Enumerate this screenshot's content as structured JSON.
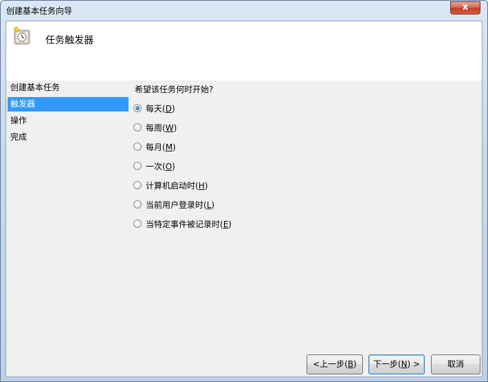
{
  "window": {
    "title": "创建基本任务向导",
    "close_glyph": "x"
  },
  "header": {
    "title": "任务触发器",
    "icon": "clock-icon"
  },
  "nav": {
    "items": [
      {
        "label": "创建基本任务",
        "selected": false
      },
      {
        "label": "触发器",
        "selected": true
      },
      {
        "label": "操作",
        "selected": false
      },
      {
        "label": "完成",
        "selected": false
      }
    ]
  },
  "content": {
    "question": "希望该任务何时开始?",
    "options": [
      {
        "text": "每天(",
        "key": "D",
        "close": ")",
        "checked": true
      },
      {
        "text": "每周(",
        "key": "W",
        "close": ")",
        "checked": false
      },
      {
        "text": "每月(",
        "key": "M",
        "close": ")",
        "checked": false
      },
      {
        "text": "一次(",
        "key": "O",
        "close": ")",
        "checked": false
      },
      {
        "text": "计算机启动时(",
        "key": "H",
        "close": ")",
        "checked": false
      },
      {
        "text": "当前用户登录时(",
        "key": "L",
        "close": ")",
        "checked": false
      },
      {
        "text": "当特定事件被记录时(",
        "key": "E",
        "close": ")",
        "checked": false
      }
    ]
  },
  "buttons": {
    "back": {
      "pre": "<上一步(",
      "key": "B",
      "post": ")"
    },
    "next": {
      "pre": "下一步(",
      "key": "N",
      "post": ") >"
    },
    "cancel": {
      "label": "取消"
    }
  }
}
